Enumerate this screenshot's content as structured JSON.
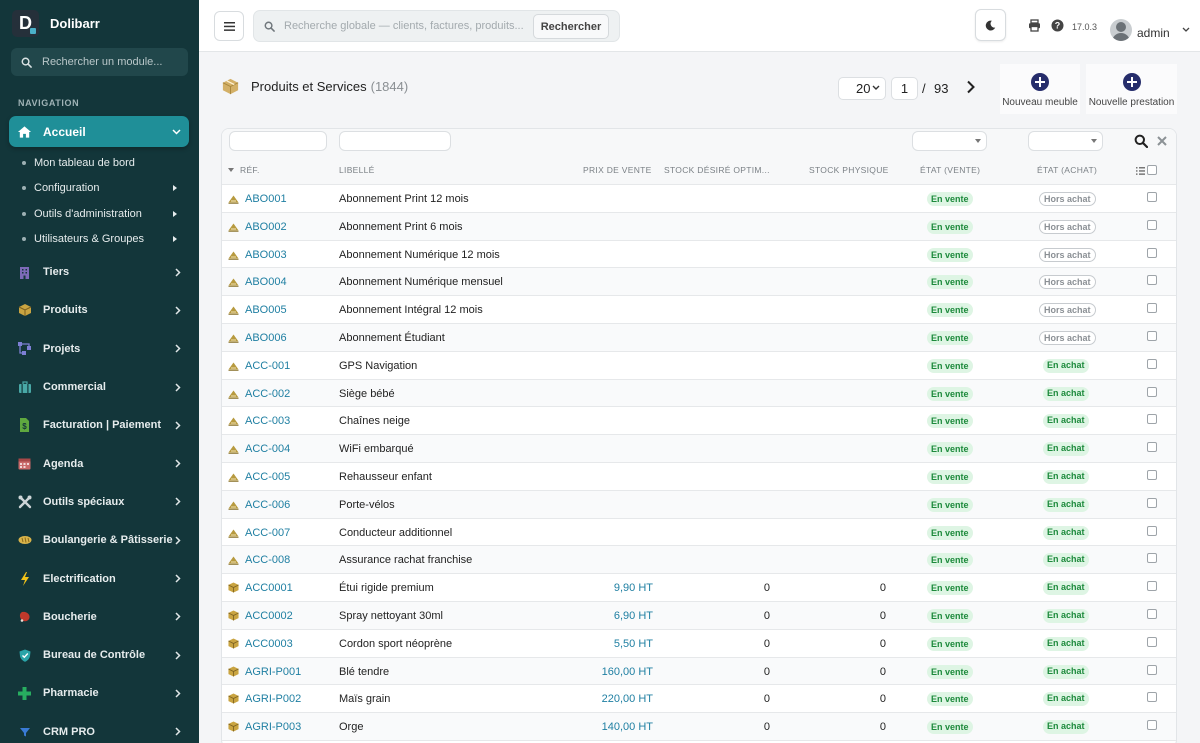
{
  "app": {
    "name": "Dolibarr"
  },
  "sidebar": {
    "search_placeholder": "Rechercher un module...",
    "heading": "NAVIGATION",
    "active": {
      "label": "Accueil",
      "icon": "home-icon"
    },
    "subitems": [
      {
        "label": "Mon tableau de bord",
        "has_submenu": false
      },
      {
        "label": "Configuration",
        "has_submenu": true
      },
      {
        "label": "Outils d'administration",
        "has_submenu": true
      },
      {
        "label": "Utilisateurs & Groupes",
        "has_submenu": true
      }
    ],
    "items": [
      {
        "label": "Tiers",
        "icon": "building-icon",
        "color": "#7d6ab8"
      },
      {
        "label": "Produits",
        "icon": "box-icon",
        "color": "#c9a441"
      },
      {
        "label": "Projets",
        "icon": "project-icon",
        "color": "#7d7fd4"
      },
      {
        "label": "Commercial",
        "icon": "briefcase-icon",
        "color": "#49a8a6"
      },
      {
        "label": "Facturation | Paiement",
        "icon": "invoice-icon",
        "color": "#5fa83f"
      },
      {
        "label": "Agenda",
        "icon": "calendar-icon",
        "color": "#c96a6a"
      },
      {
        "label": "Outils spéciaux",
        "icon": "tools-icon",
        "color": "#cdd5d7"
      },
      {
        "label": "Boulangerie & Pâtisserie",
        "icon": "bread-icon",
        "color": "#d9b44a"
      },
      {
        "label": "Electrification",
        "icon": "bolt-icon",
        "color": "#f2c318"
      },
      {
        "label": "Boucherie",
        "icon": "meat-icon",
        "color": "#c0392b"
      },
      {
        "label": "Bureau de Contrôle",
        "icon": "shield-icon",
        "color": "#2aa4a8"
      },
      {
        "label": "Pharmacie",
        "icon": "cross-icon",
        "color": "#27ae60"
      },
      {
        "label": "CRM PRO",
        "icon": "funnel-icon",
        "color": "#3a7bd5"
      }
    ]
  },
  "topbar": {
    "search_placeholder": "Recherche globale — clients, factures, produits...",
    "search_button": "Rechercher",
    "version": "17.0.3",
    "user": "admin"
  },
  "page": {
    "title": "Produits et Services",
    "count": "(1844)",
    "limit": "20",
    "current_page": "1",
    "page_sep": "/",
    "total_pages": "93",
    "actions": [
      {
        "label": "Nouveau meuble"
      },
      {
        "label": "Nouvelle prestation"
      }
    ]
  },
  "table": {
    "columns": {
      "ref": "RÉF.",
      "libelle": "LIBELLÉ",
      "prix": "PRIX DE VENTE",
      "stock_desire": "STOCK DÉSIRÉ OPTIM...",
      "stock_physique": "STOCK PHYSIQUE",
      "etat_vente": "ÉTAT (VENTE)",
      "etat_achat": "ÉTAT (ACHAT)"
    },
    "rows": [
      {
        "ref": "ABO001",
        "label": "Abonnement Print 12 mois",
        "price": "",
        "stock_desired": "",
        "stock_physical": "",
        "sale": "En vente",
        "buy": "Hors achat",
        "buy_on": false,
        "type": "service"
      },
      {
        "ref": "ABO002",
        "label": "Abonnement Print 6 mois",
        "price": "",
        "stock_desired": "",
        "stock_physical": "",
        "sale": "En vente",
        "buy": "Hors achat",
        "buy_on": false,
        "type": "service"
      },
      {
        "ref": "ABO003",
        "label": "Abonnement Numérique 12 mois",
        "price": "",
        "stock_desired": "",
        "stock_physical": "",
        "sale": "En vente",
        "buy": "Hors achat",
        "buy_on": false,
        "type": "service"
      },
      {
        "ref": "ABO004",
        "label": "Abonnement Numérique mensuel",
        "price": "",
        "stock_desired": "",
        "stock_physical": "",
        "sale": "En vente",
        "buy": "Hors achat",
        "buy_on": false,
        "type": "service"
      },
      {
        "ref": "ABO005",
        "label": "Abonnement Intégral 12 mois",
        "price": "",
        "stock_desired": "",
        "stock_physical": "",
        "sale": "En vente",
        "buy": "Hors achat",
        "buy_on": false,
        "type": "service"
      },
      {
        "ref": "ABO006",
        "label": "Abonnement Étudiant",
        "price": "",
        "stock_desired": "",
        "stock_physical": "",
        "sale": "En vente",
        "buy": "Hors achat",
        "buy_on": false,
        "type": "service"
      },
      {
        "ref": "ACC-001",
        "label": "GPS Navigation",
        "price": "",
        "stock_desired": "",
        "stock_physical": "",
        "sale": "En vente",
        "buy": "En achat",
        "buy_on": true,
        "type": "service"
      },
      {
        "ref": "ACC-002",
        "label": "Siège bébé",
        "price": "",
        "stock_desired": "",
        "stock_physical": "",
        "sale": "En vente",
        "buy": "En achat",
        "buy_on": true,
        "type": "service"
      },
      {
        "ref": "ACC-003",
        "label": "Chaînes neige",
        "price": "",
        "stock_desired": "",
        "stock_physical": "",
        "sale": "En vente",
        "buy": "En achat",
        "buy_on": true,
        "type": "service"
      },
      {
        "ref": "ACC-004",
        "label": "WiFi embarqué",
        "price": "",
        "stock_desired": "",
        "stock_physical": "",
        "sale": "En vente",
        "buy": "En achat",
        "buy_on": true,
        "type": "service"
      },
      {
        "ref": "ACC-005",
        "label": "Rehausseur enfant",
        "price": "",
        "stock_desired": "",
        "stock_physical": "",
        "sale": "En vente",
        "buy": "En achat",
        "buy_on": true,
        "type": "service"
      },
      {
        "ref": "ACC-006",
        "label": "Porte-vélos",
        "price": "",
        "stock_desired": "",
        "stock_physical": "",
        "sale": "En vente",
        "buy": "En achat",
        "buy_on": true,
        "type": "service"
      },
      {
        "ref": "ACC-007",
        "label": "Conducteur additionnel",
        "price": "",
        "stock_desired": "",
        "stock_physical": "",
        "sale": "En vente",
        "buy": "En achat",
        "buy_on": true,
        "type": "service"
      },
      {
        "ref": "ACC-008",
        "label": "Assurance rachat franchise",
        "price": "",
        "stock_desired": "",
        "stock_physical": "",
        "sale": "En vente",
        "buy": "En achat",
        "buy_on": true,
        "type": "service"
      },
      {
        "ref": "ACC0001",
        "label": "Étui rigide premium",
        "price": "9,90 HT",
        "stock_desired": "0",
        "stock_physical": "0",
        "sale": "En vente",
        "buy": "En achat",
        "buy_on": true,
        "type": "product"
      },
      {
        "ref": "ACC0002",
        "label": "Spray nettoyant 30ml",
        "price": "6,90 HT",
        "stock_desired": "0",
        "stock_physical": "0",
        "sale": "En vente",
        "buy": "En achat",
        "buy_on": true,
        "type": "product"
      },
      {
        "ref": "ACC0003",
        "label": "Cordon sport néoprène",
        "price": "5,50 HT",
        "stock_desired": "0",
        "stock_physical": "0",
        "sale": "En vente",
        "buy": "En achat",
        "buy_on": true,
        "type": "product"
      },
      {
        "ref": "AGRI-P001",
        "label": "Blé tendre",
        "price": "160,00 HT",
        "stock_desired": "0",
        "stock_physical": "0",
        "sale": "En vente",
        "buy": "En achat",
        "buy_on": true,
        "type": "product"
      },
      {
        "ref": "AGRI-P002",
        "label": "Maïs grain",
        "price": "220,00 HT",
        "stock_desired": "0",
        "stock_physical": "0",
        "sale": "En vente",
        "buy": "En achat",
        "buy_on": true,
        "type": "product"
      },
      {
        "ref": "AGRI-P003",
        "label": "Orge",
        "price": "140,00 HT",
        "stock_desired": "0",
        "stock_physical": "0",
        "sale": "En vente",
        "buy": "En achat",
        "buy_on": true,
        "type": "product"
      }
    ]
  }
}
